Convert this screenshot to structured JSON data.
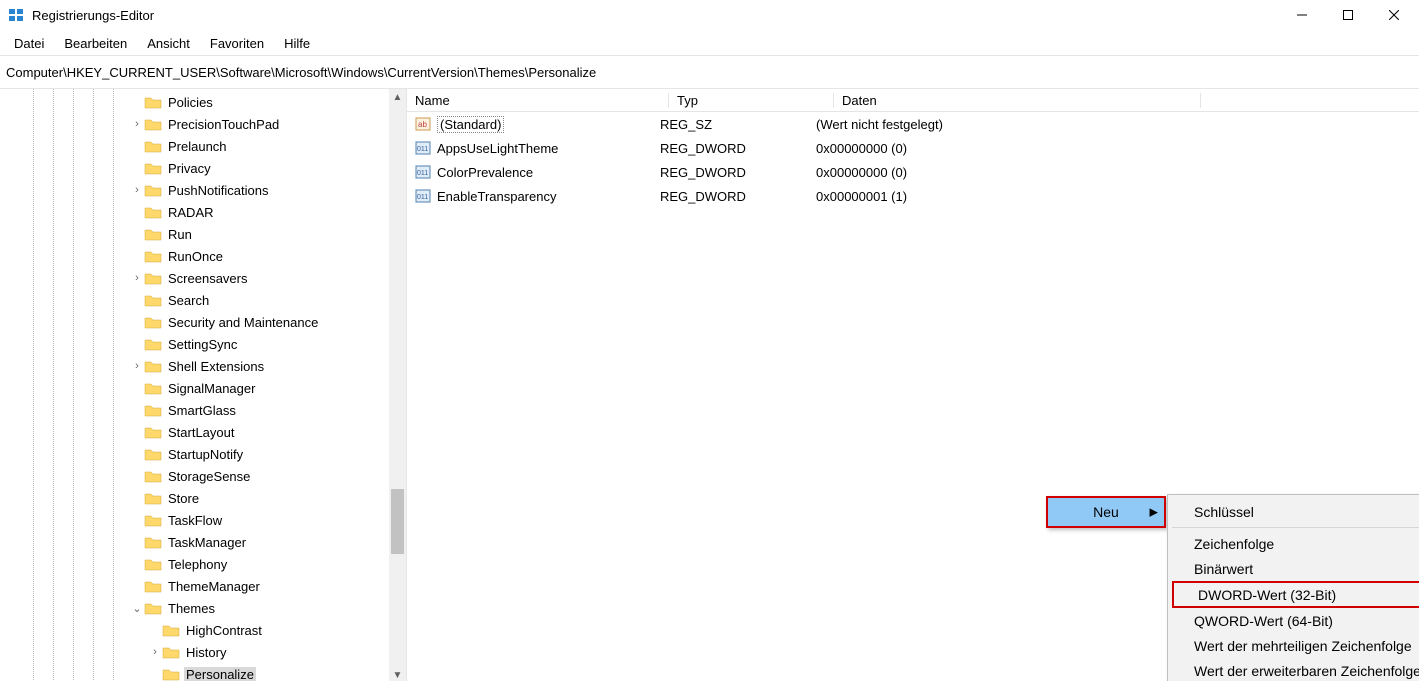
{
  "window": {
    "title": "Registrierungs-Editor",
    "menus": [
      "Datei",
      "Bearbeiten",
      "Ansicht",
      "Favoriten",
      "Hilfe"
    ],
    "path": "Computer\\HKEY_CURRENT_USER\\Software\\Microsoft\\Windows\\CurrentVersion\\Themes\\Personalize"
  },
  "tree": [
    {
      "exp": "",
      "depth": 0,
      "label": "Policies"
    },
    {
      "exp": "›",
      "depth": 0,
      "label": "PrecisionTouchPad"
    },
    {
      "exp": "",
      "depth": 0,
      "label": "Prelaunch"
    },
    {
      "exp": "",
      "depth": 0,
      "label": "Privacy"
    },
    {
      "exp": "›",
      "depth": 0,
      "label": "PushNotifications"
    },
    {
      "exp": "",
      "depth": 0,
      "label": "RADAR"
    },
    {
      "exp": "",
      "depth": 0,
      "label": "Run"
    },
    {
      "exp": "",
      "depth": 0,
      "label": "RunOnce"
    },
    {
      "exp": "›",
      "depth": 0,
      "label": "Screensavers"
    },
    {
      "exp": "",
      "depth": 0,
      "label": "Search"
    },
    {
      "exp": "",
      "depth": 0,
      "label": "Security and Maintenance"
    },
    {
      "exp": "",
      "depth": 0,
      "label": "SettingSync"
    },
    {
      "exp": "›",
      "depth": 0,
      "label": "Shell Extensions"
    },
    {
      "exp": "",
      "depth": 0,
      "label": "SignalManager"
    },
    {
      "exp": "",
      "depth": 0,
      "label": "SmartGlass"
    },
    {
      "exp": "",
      "depth": 0,
      "label": "StartLayout"
    },
    {
      "exp": "",
      "depth": 0,
      "label": "StartupNotify"
    },
    {
      "exp": "",
      "depth": 0,
      "label": "StorageSense"
    },
    {
      "exp": "",
      "depth": 0,
      "label": "Store"
    },
    {
      "exp": "",
      "depth": 0,
      "label": "TaskFlow"
    },
    {
      "exp": "",
      "depth": 0,
      "label": "TaskManager"
    },
    {
      "exp": "",
      "depth": 0,
      "label": "Telephony"
    },
    {
      "exp": "",
      "depth": 0,
      "label": "ThemeManager"
    },
    {
      "exp": "⌄",
      "depth": 0,
      "label": "Themes"
    },
    {
      "exp": "",
      "depth": 1,
      "label": "HighContrast"
    },
    {
      "exp": "›",
      "depth": 1,
      "label": "History"
    },
    {
      "exp": "",
      "depth": 1,
      "label": "Personalize",
      "sel": true
    }
  ],
  "columns": {
    "name": "Name",
    "type": "Typ",
    "data": "Daten"
  },
  "values": [
    {
      "icon": "sz",
      "name": "(Standard)",
      "type": "REG_SZ",
      "data": "(Wert nicht festgelegt)",
      "dotted": true
    },
    {
      "icon": "dw",
      "name": "AppsUseLightTheme",
      "type": "REG_DWORD",
      "data": "0x00000000 (0)"
    },
    {
      "icon": "dw",
      "name": "ColorPrevalence",
      "type": "REG_DWORD",
      "data": "0x00000000 (0)"
    },
    {
      "icon": "dw",
      "name": "EnableTransparency",
      "type": "REG_DWORD",
      "data": "0x00000001 (1)"
    }
  ],
  "ctx1": {
    "label": "Neu"
  },
  "ctx2": [
    {
      "label": "Schlüssel"
    },
    {
      "sep": true
    },
    {
      "label": "Zeichenfolge"
    },
    {
      "label": "Binärwert"
    },
    {
      "label": "DWORD-Wert (32-Bit)",
      "hl": true
    },
    {
      "label": "QWORD-Wert (64-Bit)"
    },
    {
      "label": "Wert der mehrteiligen Zeichenfolge"
    },
    {
      "label": "Wert der erweiterbaren Zeichenfolge"
    }
  ]
}
